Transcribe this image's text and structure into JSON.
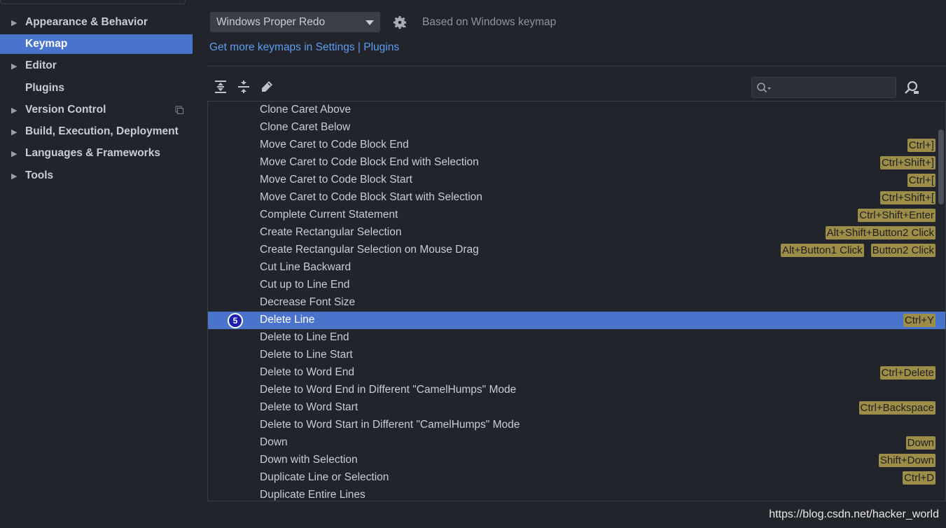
{
  "sidebar": {
    "items": [
      {
        "label": "Appearance & Behavior",
        "expandable": true,
        "selected": false,
        "badge": false
      },
      {
        "label": "Keymap",
        "expandable": false,
        "selected": true,
        "badge": false
      },
      {
        "label": "Editor",
        "expandable": true,
        "selected": false,
        "badge": false
      },
      {
        "label": "Plugins",
        "expandable": false,
        "selected": false,
        "badge": false
      },
      {
        "label": "Version Control",
        "expandable": true,
        "selected": false,
        "badge": true
      },
      {
        "label": "Build, Execution, Deployment",
        "expandable": true,
        "selected": false,
        "badge": false
      },
      {
        "label": "Languages & Frameworks",
        "expandable": true,
        "selected": false,
        "badge": false
      },
      {
        "label": "Tools",
        "expandable": true,
        "selected": false,
        "badge": false
      }
    ]
  },
  "header": {
    "keymap_value": "Windows Proper Redo",
    "based_on": "Based on Windows keymap",
    "more_link": "Get more keymaps in Settings | Plugins"
  },
  "search": {
    "value": "",
    "placeholder": ""
  },
  "actions": [
    {
      "name": "Clone Caret Above",
      "shortcuts": []
    },
    {
      "name": "Clone Caret Below",
      "shortcuts": []
    },
    {
      "name": "Move Caret to Code Block End",
      "shortcuts": [
        "Ctrl+]"
      ]
    },
    {
      "name": "Move Caret to Code Block End with Selection",
      "shortcuts": [
        "Ctrl+Shift+]"
      ]
    },
    {
      "name": "Move Caret to Code Block Start",
      "shortcuts": [
        "Ctrl+["
      ]
    },
    {
      "name": "Move Caret to Code Block Start with Selection",
      "shortcuts": [
        "Ctrl+Shift+["
      ]
    },
    {
      "name": "Complete Current Statement",
      "shortcuts": [
        "Ctrl+Shift+Enter"
      ]
    },
    {
      "name": "Create Rectangular Selection",
      "shortcuts": [
        "Alt+Shift+Button2 Click"
      ]
    },
    {
      "name": "Create Rectangular Selection on Mouse Drag",
      "shortcuts": [
        "Alt+Button1 Click",
        "Button2 Click"
      ]
    },
    {
      "name": "Cut Line Backward",
      "shortcuts": []
    },
    {
      "name": "Cut up to Line End",
      "shortcuts": []
    },
    {
      "name": "Decrease Font Size",
      "shortcuts": []
    },
    {
      "name": "Delete Line",
      "shortcuts": [
        "Ctrl+Y"
      ],
      "selected": true,
      "marker": "5"
    },
    {
      "name": "Delete to Line End",
      "shortcuts": []
    },
    {
      "name": "Delete to Line Start",
      "shortcuts": []
    },
    {
      "name": "Delete to Word End",
      "shortcuts": [
        "Ctrl+Delete"
      ]
    },
    {
      "name": "Delete to Word End in Different \"CamelHumps\" Mode",
      "shortcuts": []
    },
    {
      "name": "Delete to Word Start",
      "shortcuts": [
        "Ctrl+Backspace"
      ]
    },
    {
      "name": "Delete to Word Start in Different \"CamelHumps\" Mode",
      "shortcuts": []
    },
    {
      "name": "Down",
      "shortcuts": [
        "Down"
      ]
    },
    {
      "name": "Down with Selection",
      "shortcuts": [
        "Shift+Down"
      ]
    },
    {
      "name": "Duplicate Line or Selection",
      "shortcuts": [
        "Ctrl+D"
      ]
    },
    {
      "name": "Duplicate Entire Lines",
      "shortcuts": []
    }
  ],
  "watermark": "https://blog.csdn.net/hacker_world",
  "colors": {
    "background": "#21252b",
    "selection": "#4a74cc",
    "shortcut_chip": "#9c8e49",
    "link": "#5e9cf0"
  },
  "icons": {
    "expand_all": "expand-all-icon",
    "collapse_all": "collapse-all-icon",
    "edit": "pencil-icon",
    "settings": "gear-icon",
    "search": "search-icon",
    "find_shortcut": "find-by-shortcut-icon"
  }
}
